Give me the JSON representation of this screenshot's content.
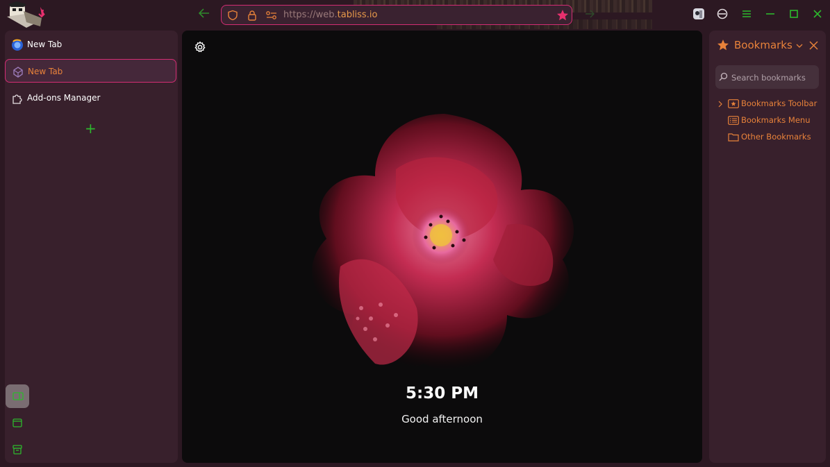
{
  "toolbar": {
    "url_prefix": "https://web.",
    "url_host": "tabliss.io",
    "accent": "#d42d74",
    "nav_color": "#2db82d"
  },
  "sidebar": {
    "tabs": [
      {
        "label": "New Tab",
        "icon": "firefox-icon"
      },
      {
        "label": "New Tab",
        "icon": "tabliss-icon",
        "active": true
      },
      {
        "label": "Add-ons Manager",
        "icon": "puzzle-icon"
      }
    ],
    "new_tab_symbol": "+",
    "bottom_buttons": [
      "sidebar-toggle-icon",
      "window-icon",
      "archive-icon"
    ]
  },
  "page": {
    "time": "5:30 PM",
    "greeting": "Good afternoon"
  },
  "bookmarks": {
    "title": "Bookmarks",
    "search_placeholder": "Search bookmarks",
    "items": [
      {
        "label": "Bookmarks Toolbar",
        "icon": "star-folder-icon",
        "expandable": true
      },
      {
        "label": "Bookmarks Menu",
        "icon": "menu-list-icon"
      },
      {
        "label": "Other Bookmarks",
        "icon": "folder-icon"
      }
    ],
    "color": "#e8823a"
  }
}
